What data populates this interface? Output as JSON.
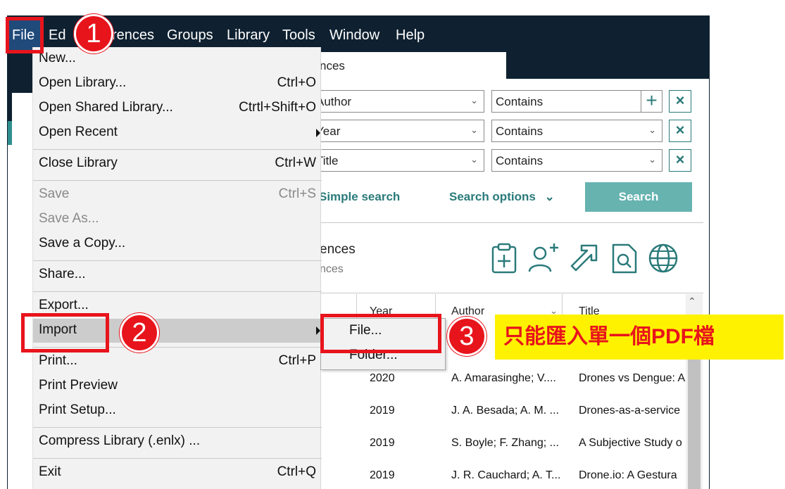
{
  "menubar": {
    "items": [
      "File",
      "Ed",
      "rences",
      "Groups",
      "Library",
      "Tools",
      "Window",
      "Help"
    ]
  },
  "tab": {
    "label": "nces"
  },
  "search": {
    "rows": [
      {
        "field": "Author",
        "op": "Contains"
      },
      {
        "field": "Year",
        "op": "Contains"
      },
      {
        "field": "Title",
        "op": "Contains"
      }
    ],
    "simple_label": "Simple search",
    "options_label": "Search options",
    "button_label": "Search"
  },
  "library": {
    "title": "ences",
    "subtitle": "nces"
  },
  "file_menu": {
    "new": "New...",
    "open_library": "Open Library...",
    "open_library_sc": "Ctrl+O",
    "open_shared": "Open Shared Library...",
    "open_shared_sc": "Ctrtl+Shift+O",
    "open_recent": "Open Recent",
    "close_library": "Close Library",
    "close_library_sc": "Ctrl+W",
    "save": "Save",
    "save_sc": "Ctrl+S",
    "save_as": "Save As...",
    "save_copy": "Save a Copy...",
    "share": "Share...",
    "export": "Export...",
    "import": "Import",
    "print": "Print...",
    "print_sc": "Ctrl+P",
    "print_preview": "Print Preview",
    "print_setup": "Print Setup...",
    "compress": "Compress Library (.enlx) ...",
    "exit": "Exit",
    "exit_sc": "Ctrl+Q"
  },
  "import_submenu": {
    "file": "File...",
    "folder": "Folder..."
  },
  "table": {
    "headers": {
      "year": "Year",
      "author": "Author",
      "title": "Title"
    },
    "rows": [
      {
        "year": "2020",
        "author": "A. Amarasinghe; V....",
        "title": "Drones vs Dengue: A"
      },
      {
        "year": "2019",
        "author": "J. A. Besada; A. M. ...",
        "title": "Drones-as-a-service"
      },
      {
        "year": "2019",
        "author": "S. Boyle; F. Zhang; ...",
        "title": "A Subjective Study o"
      },
      {
        "year": "2019",
        "author": "J. R. Cauchard; A. T...",
        "title": "Drone.io: A Gestura"
      }
    ]
  },
  "annotations": {
    "step1": "1",
    "step2": "2",
    "step3": "3",
    "callout": "只能匯入單一個PDF檔",
    "highlight_color": "#e8141c",
    "callout_bg": "#fff200"
  },
  "colors": {
    "menubar": "#0f2131",
    "accent": "#2b7a7a",
    "search_button": "#66b3b0"
  },
  "icons": [
    "clipboard-plus-icon",
    "add-user-icon",
    "share-arrow-icon",
    "pdf-search-icon",
    "globe-icon"
  ]
}
